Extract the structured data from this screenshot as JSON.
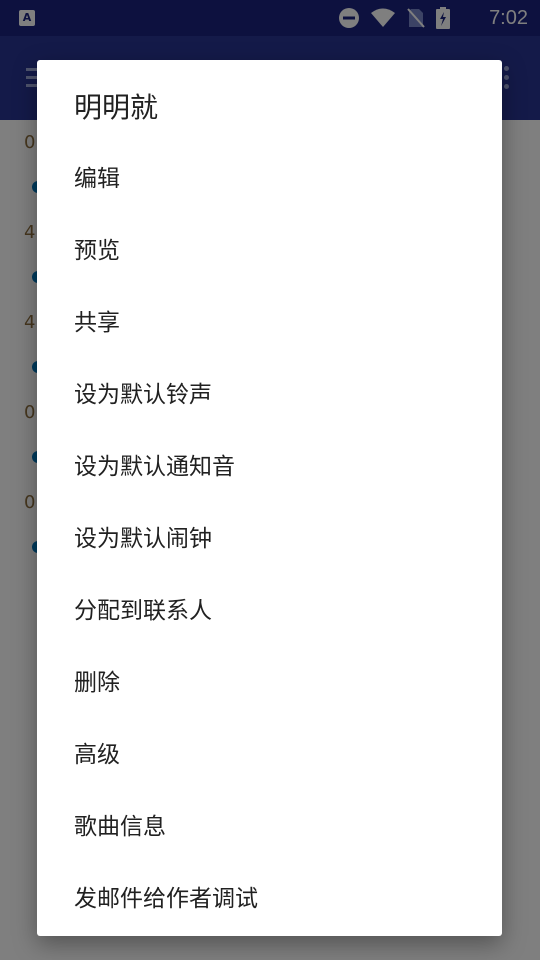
{
  "status_bar": {
    "app_badge": "A",
    "time": "7:02",
    "icons": [
      "do-not-disturb-icon",
      "wifi-icon",
      "no-sim-icon",
      "battery-charging-icon"
    ]
  },
  "toolbar": {
    "menu_icon": "menu-icon",
    "more_icon": "more-vert-icon"
  },
  "background_list": {
    "row_snippets": [
      "0",
      "4",
      "4",
      "0",
      "0"
    ]
  },
  "dialog": {
    "title": "明明就",
    "items": [
      "编辑",
      "预览",
      "共享",
      "设为默认铃声",
      "设为默认通知音",
      "设为默认闹钟",
      "分配到联系人",
      "删除",
      "高级",
      "歌曲信息",
      "发邮件给作者调试"
    ]
  },
  "colors": {
    "status_bar": "#1a237e",
    "toolbar": "#283593",
    "list_accent_text": "#8d6e3f",
    "list_dot": "#0277bd",
    "dialog_bg": "#ffffff",
    "dialog_text": "#212121"
  }
}
